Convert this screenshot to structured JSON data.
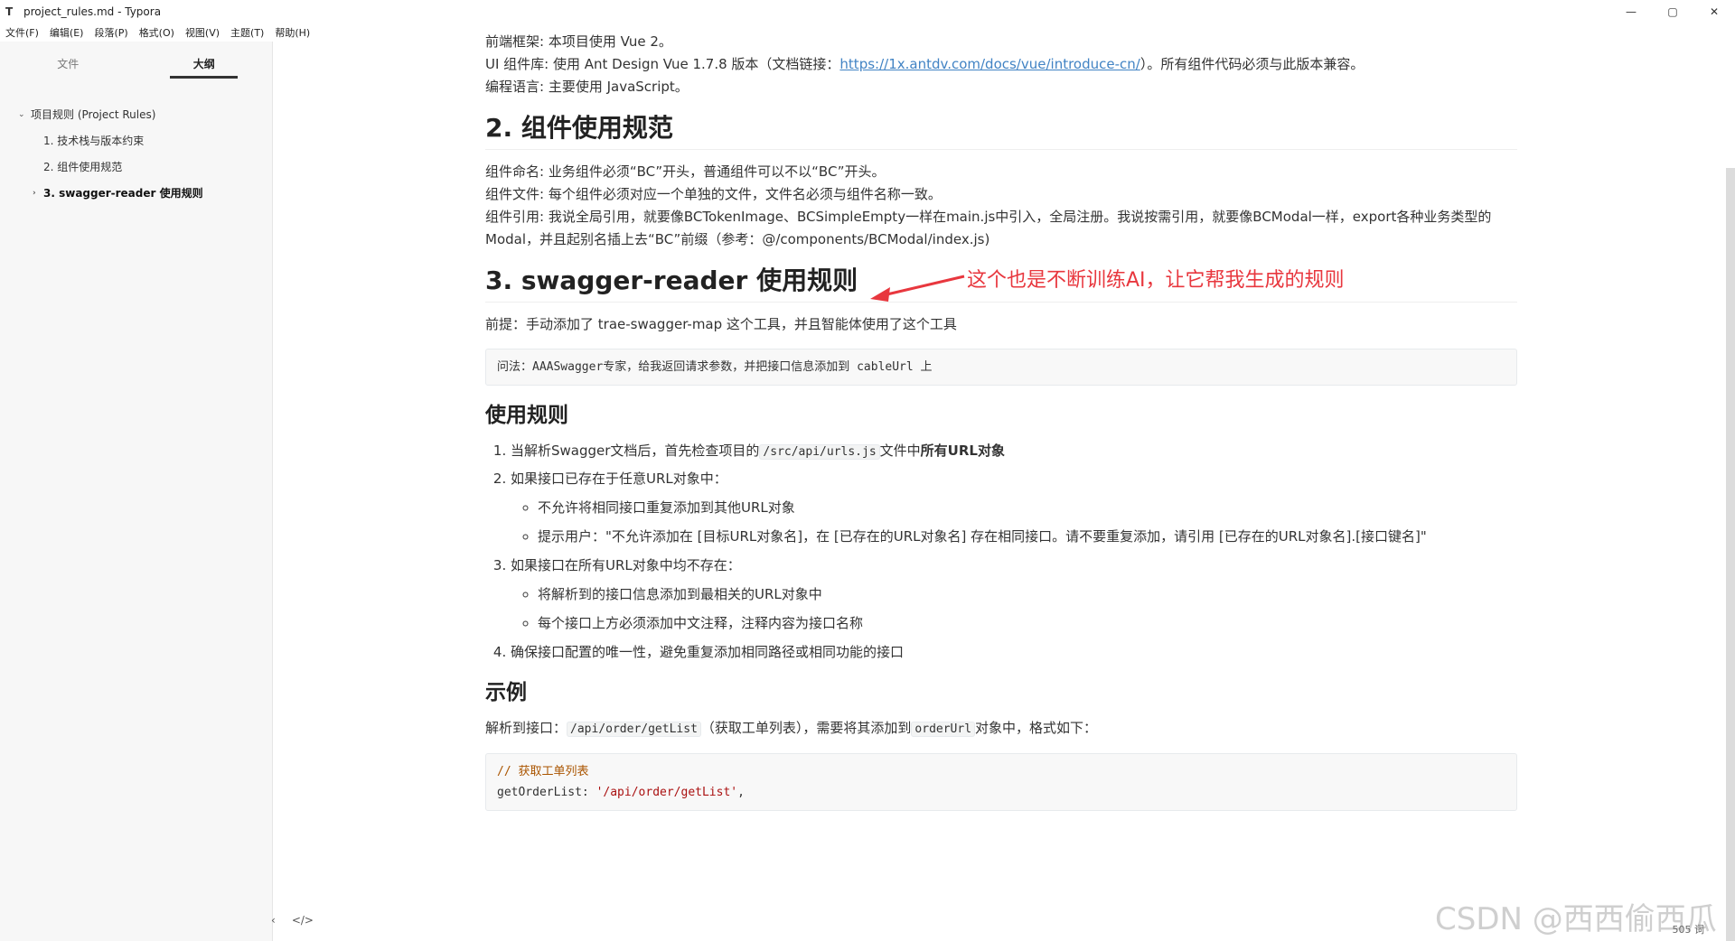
{
  "window": {
    "app_icon": "T",
    "title": "project_rules.md - Typora",
    "controls": [
      "—",
      "▢",
      "✕"
    ]
  },
  "menu": [
    "文件(F)",
    "编辑(E)",
    "段落(P)",
    "格式(O)",
    "视图(V)",
    "主题(T)",
    "帮助(H)"
  ],
  "sidebar": {
    "tabs": [
      "文件",
      "大纲"
    ],
    "outline": [
      {
        "label": "项目规则 (Project Rules)",
        "twisty": "⌄"
      },
      {
        "label": "1. 技术栈与版本约束"
      },
      {
        "label": "2. 组件使用规范"
      },
      {
        "label": "3. swagger-reader 使用规则",
        "twisty": "›"
      }
    ],
    "footer_back": "‹",
    "footer_source": "</>"
  },
  "doc": {
    "p1": "前端框架: 本项目使用 Vue 2。",
    "p2_pre": "UI 组件库: 使用 Ant Design Vue 1.7.8 版本（文档链接：",
    "p2_link": "https://1x.antdv.com/docs/vue/introduce-cn/",
    "p2_post": "）。所有组件代码必须与此版本兼容。",
    "p3": "编程语言: 主要使用 JavaScript。",
    "h2_components": "2. 组件使用规范",
    "c1": "组件命名: 业务组件必须“BC”开头，普通组件可以不以“BC”开头。",
    "c2": "组件文件: 每个组件必须对应一个单独的文件，文件名必须与组件名称一致。",
    "c3": "组件引用: 我说全局引用，就要像BCTokenImage、BCSimpleEmpty一样在main.js中引入，全局注册。我说按需引用，就要像BCModal一样，export各种业务类型的Modal，并且起别名插上去“BC”前缀（参考：@/components/BCModal/index.js)",
    "h2_swagger": "3. swagger-reader 使用规则",
    "premise": "前提：手动添加了 trae-swagger-map 这个工具，并且智能体使用了这个工具",
    "ask": "问法：AAASwagger专家，给我返回请求参数，并把接口信息添加到 cableUrl 上",
    "h3_rules": "使用规则",
    "r1_pre": "当解析Swagger文档后，首先检查项目的",
    "r1_code": "/src/api/urls.js",
    "r1_mid": "文件中",
    "r1_bold": "所有URL对象",
    "r2": "如果接口已存在于任意URL对象中：",
    "r2a": "不允许将相同接口重复添加到其他URL对象",
    "r2b": "提示用户：\"不允许添加在 [目标URL对象名]，在 [已存在的URL对象名] 存在相同接口。请不要重复添加，请引用 [已存在的URL对象名].[接口键名]\"",
    "r3": "如果接口在所有URL对象中均不存在：",
    "r3a": "将解析到的接口信息添加到最相关的URL对象中",
    "r3b": "每个接口上方必须添加中文注释，注释内容为接口名称",
    "r4": "确保接口配置的唯一性，避免重复添加相同路径或相同功能的接口",
    "h3_example": "示例",
    "ex_pre": "解析到接口：",
    "ex_code": "/api/order/getList",
    "ex_mid": "（获取工单列表），需要将其添加到",
    "ex_code2": "orderUrl",
    "ex_post": "对象中，格式如下：",
    "code_comment": "// 获取工单列表",
    "code_key": "getOrderList: ",
    "code_str": "'/api/order/getList'",
    "code_end": ","
  },
  "annotation": "这个也是不断训练AI，让它帮我生成的规则",
  "watermark": "CSDN @西西偷西瓜",
  "wordcount": "505 词"
}
